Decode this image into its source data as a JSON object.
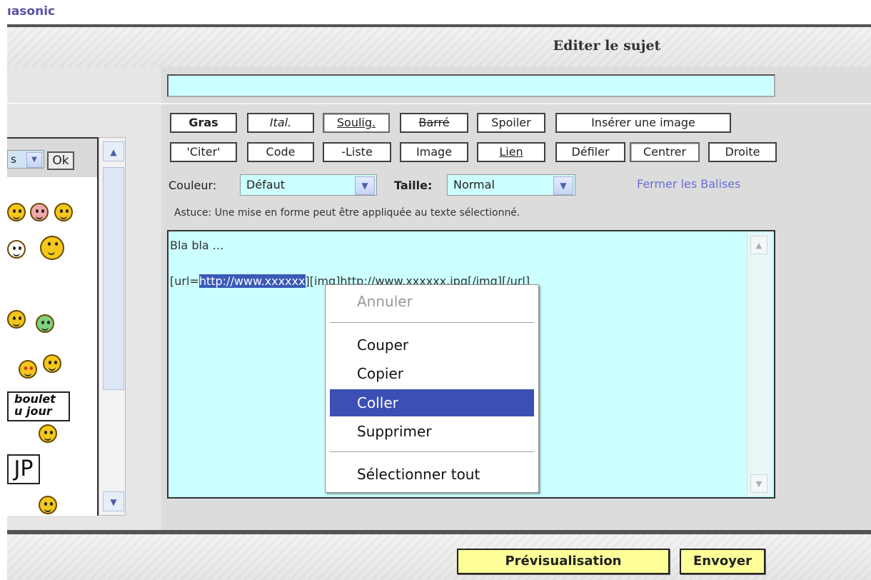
{
  "brand": "ıasonic",
  "header": {
    "title": "Editer le sujet"
  },
  "subject": {
    "value": ""
  },
  "toolbar": {
    "row1": [
      "Gras",
      "Ital.",
      "Soulig.",
      "Barré",
      "Spoiler",
      "Insérer une image"
    ],
    "row2": [
      "'Citer'",
      "Code",
      "-Liste",
      "Image",
      "Lien",
      "Défiler",
      "Centrer",
      "Droite"
    ]
  },
  "format": {
    "couleur_label": "Couleur:",
    "couleur_value": "Défaut",
    "taille_label": "Taille:",
    "taille_value": "Normal",
    "close_tags": "Fermer les Balises",
    "hint": "Astuce: Une mise en forme peut être appliquée au texte sélectionné."
  },
  "message": {
    "line1": "Bla bla ...",
    "line2_before": "[url=",
    "line2_selected": "http://www.xxxxxx",
    "line2_after": "][img]http://www.xxxxxx.jpg[/img][/url]"
  },
  "context_menu": {
    "items": [
      "Annuler",
      "Couper",
      "Copier",
      "Coller",
      "Supprimer",
      "Sélectionner tout"
    ],
    "disabled": "Annuler",
    "highlighted": "Coller"
  },
  "smilies": {
    "select_value": "s",
    "ok_label": "Ok",
    "boulet_line1": "boulet",
    "boulet_line2": "u jour",
    "up_sign": "JP"
  },
  "actions": {
    "preview": "Prévisualisation",
    "send": "Envoyer"
  },
  "colors": {
    "input_bg": "#ccffff",
    "selection": "#3a5ab8",
    "menu_highlight": "#3c4fb5",
    "action_button": "#ffff99",
    "link": "#6b6bd6",
    "brand": "#5a52a8"
  }
}
